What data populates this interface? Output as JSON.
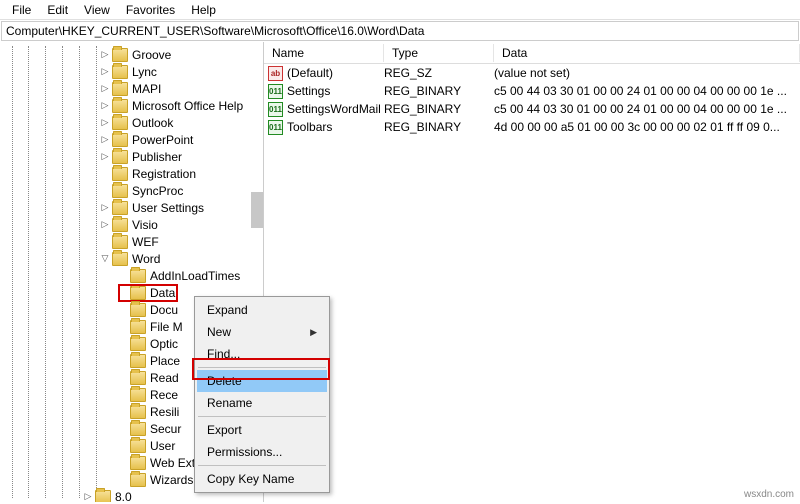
{
  "menu": {
    "items": [
      "File",
      "Edit",
      "View",
      "Favorites",
      "Help"
    ]
  },
  "addressbar": "Computer\\HKEY_CURRENT_USER\\Software\\Microsoft\\Office\\16.0\\Word\\Data",
  "tree": {
    "level1": [
      {
        "expander": "▷",
        "label": "Groove"
      },
      {
        "expander": "▷",
        "label": "Lync"
      },
      {
        "expander": "▷",
        "label": "MAPI"
      },
      {
        "expander": "▷",
        "label": "Microsoft Office Help"
      },
      {
        "expander": "▷",
        "label": "Outlook"
      },
      {
        "expander": "▷",
        "label": "PowerPoint"
      },
      {
        "expander": "▷",
        "label": "Publisher"
      },
      {
        "expander": "",
        "label": "Registration"
      },
      {
        "expander": "",
        "label": "SyncProc"
      },
      {
        "expander": "▷",
        "label": "User Settings"
      },
      {
        "expander": "▷",
        "label": "Visio"
      },
      {
        "expander": "",
        "label": "WEF"
      },
      {
        "expander": "▽",
        "label": "Word"
      }
    ],
    "wordChildren": [
      "AddInLoadTimes",
      "Data",
      "Docu",
      "File M",
      "Optic",
      "Place",
      "Read",
      "Rece",
      "Resili",
      "Secur",
      "User",
      "Web Extension List",
      "Wizards"
    ],
    "level1_tail": [
      {
        "expander": "▷",
        "label": "8.0"
      }
    ]
  },
  "list": {
    "headers": {
      "name": "Name",
      "type": "Type",
      "data": "Data"
    },
    "rows": [
      {
        "icon": "str",
        "name": "(Default)",
        "type": "REG_SZ",
        "data": "(value not set)"
      },
      {
        "icon": "bin",
        "name": "Settings",
        "type": "REG_BINARY",
        "data": "c5 00 44 03 30 01 00 00 24 01 00 00 04 00 00 00 1e ..."
      },
      {
        "icon": "bin",
        "name": "SettingsWordMail",
        "type": "REG_BINARY",
        "data": "c5 00 44 03 30 01 00 00 24 01 00 00 04 00 00 00 1e ..."
      },
      {
        "icon": "bin",
        "name": "Toolbars",
        "type": "REG_BINARY",
        "data": "4d 00 00 00 a5 01 00 00 3c 00 00 00 02 01 ff ff 09 0..."
      }
    ]
  },
  "context": {
    "expand": "Expand",
    "new": "New",
    "find": "Find...",
    "delete": "Delete",
    "rename": "Rename",
    "export": "Export",
    "permissions": "Permissions...",
    "copy": "Copy Key Name"
  },
  "watermark": "wsxdn.com"
}
